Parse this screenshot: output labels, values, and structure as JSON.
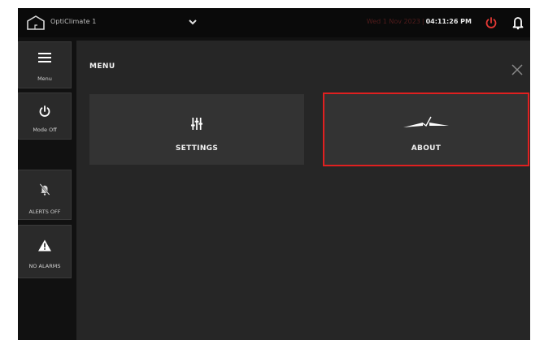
{
  "topbar": {
    "device_name": "OptiClimate 1",
    "date": "Wed 1 Nov 2023",
    "time": "04:11:26 PM"
  },
  "sidebar": {
    "menu_label": "Menu",
    "mode_label": "Mode Off",
    "alerts_label": "ALERTS OFF",
    "alarms_label": "NO ALARMS"
  },
  "menu": {
    "title": "MENU",
    "settings_label": "SETTINGS",
    "about_label": "ABOUT"
  },
  "colors": {
    "accent_red": "#e02020",
    "power_red": "#e53935",
    "panel": "#262626",
    "tile": "#333333"
  },
  "icons": [
    "home-icon",
    "chevron-down-icon",
    "power-icon",
    "bell-icon",
    "hamburger-icon",
    "mute-bell-icon",
    "warning-icon",
    "close-icon",
    "sliders-icon",
    "logo-icon"
  ]
}
